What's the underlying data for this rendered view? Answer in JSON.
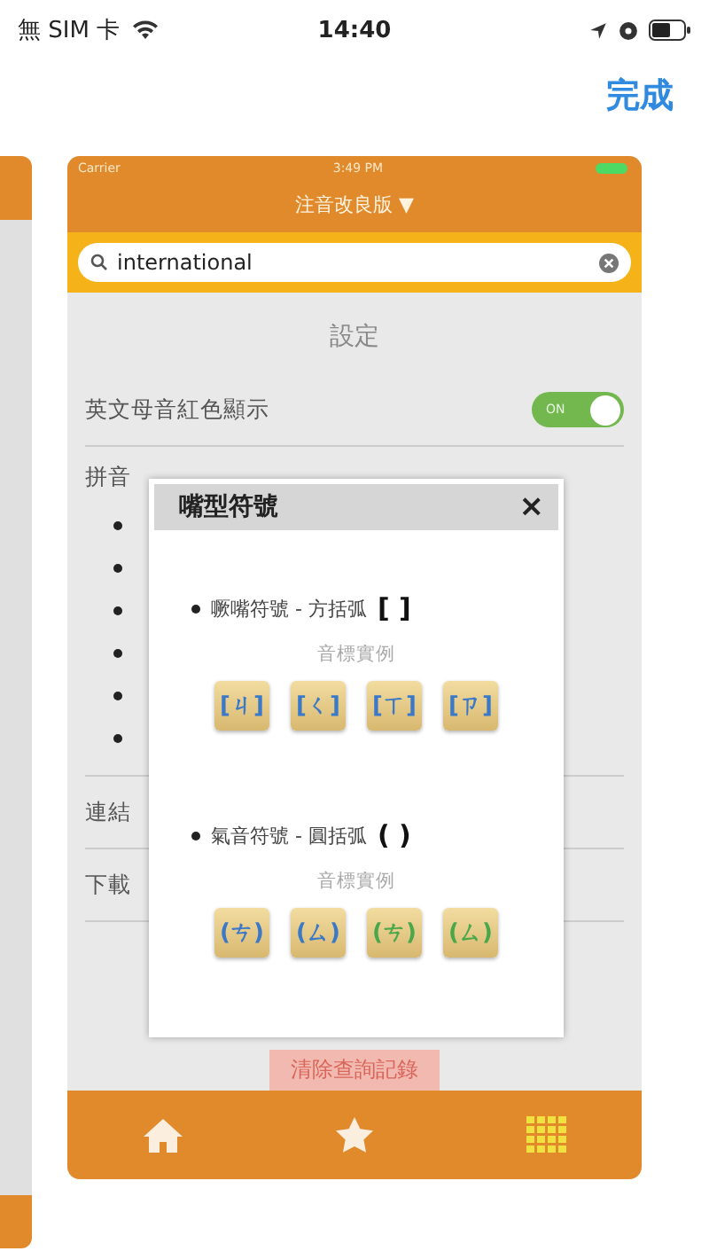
{
  "status_bar": {
    "carrier": "無 SIM 卡",
    "time": "14:40"
  },
  "done_button": "完成",
  "preview": {
    "status_bar": {
      "carrier": "Carrier",
      "time": "3:49 PM"
    },
    "title": "注音改良版 ▼",
    "search": {
      "value": "international"
    },
    "section_title": "設定",
    "rows": [
      {
        "kind": "toggle",
        "label": "英文母音紅色顯示",
        "on": true,
        "toggle_text": "ON"
      },
      {
        "kind": "list",
        "label": "拼音"
      },
      {
        "kind": "plain",
        "label": "連結"
      },
      {
        "kind": "plain",
        "label": "下載"
      }
    ],
    "clear_button": "清除查詢記錄",
    "popup": {
      "title": "嘴型符號",
      "close": "×",
      "sections": [
        {
          "label": "噘嘴符號 - 方括弧",
          "symbol": "[ ]",
          "caption": "音標實例",
          "tiles": [
            {
              "text": "[ㄐ]",
              "color": "#3a78c8"
            },
            {
              "text": "[ㄑ]",
              "color": "#3a78c8"
            },
            {
              "text": "[ㄒ]",
              "color": "#3a78c8"
            },
            {
              "text": "[ㄗ]",
              "color": "#3a78c8"
            }
          ]
        },
        {
          "label": "氣音符號 - 圓括弧",
          "symbol": "( )",
          "caption": "音標實例",
          "tiles": [
            {
              "text": "(ㄘ)",
              "color": "#3a78c8"
            },
            {
              "text": "(ㄙ)",
              "color": "#3a78c8"
            },
            {
              "text": "(ㄘ)",
              "color": "#4aa84a"
            },
            {
              "text": "(ㄙ)",
              "color": "#4aa84a"
            }
          ]
        }
      ]
    },
    "tabs": [
      {
        "kind": "home",
        "selected": false
      },
      {
        "kind": "star",
        "selected": false
      },
      {
        "kind": "grid",
        "selected": true
      }
    ]
  }
}
